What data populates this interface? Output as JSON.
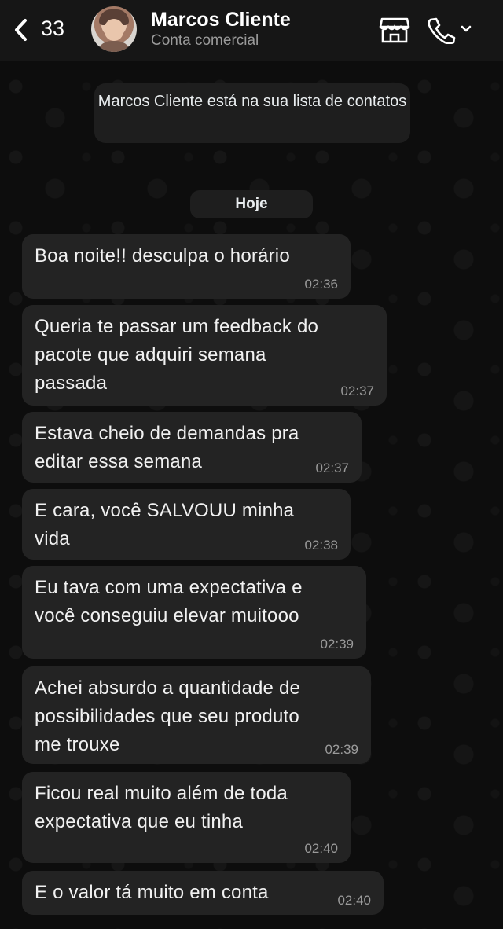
{
  "header": {
    "back_count": "33",
    "contact_name": "Marcos Cliente",
    "contact_subtitle": "Conta comercial",
    "icons": [
      "back-chevron-icon",
      "storefront-icon",
      "phone-icon",
      "chevron-down-icon"
    ]
  },
  "system_notice": "Marcos Cliente está na sua lista de contatos",
  "date_chip": "Hoje",
  "messages": [
    {
      "text": "Boa noite!! desculpa o horário",
      "time": "02:36"
    },
    {
      "text": "Queria te passar um feedback do\npacote que adquiri semana\npassada",
      "time": "02:37"
    },
    {
      "text": "Estava cheio de demandas pra\neditar essa semana",
      "time": "02:37"
    },
    {
      "text": "E cara, você SALVOUU minha\nvida",
      "time": "02:38"
    },
    {
      "text": "Eu tava com uma expectativa e\nvocê conseguiu elevar muitooo",
      "time": "02:39"
    },
    {
      "text": "Achei absurdo a quantidade de\npossibilidades que seu produto\nme trouxe",
      "time": "02:39"
    },
    {
      "text": "Ficou real muito além de toda\nexpectativa que eu tinha",
      "time": "02:40"
    },
    {
      "text": "E o valor tá muito em conta",
      "time": "02:40"
    }
  ]
}
